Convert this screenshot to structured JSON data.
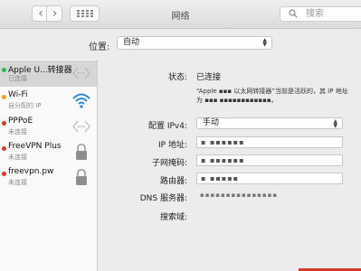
{
  "window": {
    "title": "网络"
  },
  "toolbar": {
    "back_glyph": "‹",
    "forward_glyph": "›"
  },
  "search": {
    "placeholder": "搜索"
  },
  "location": {
    "label": "位置:",
    "value": "自动"
  },
  "services": [
    {
      "name": "Apple U...转接器",
      "status": "已连接",
      "status_color": "#2fbd4a",
      "icon": "ethernet-arrows-icon"
    },
    {
      "name": "Wi-Fi",
      "status": "自分配的 IP",
      "status_color": "#f0a020",
      "icon": "wifi-icon"
    },
    {
      "name": "PPPoE",
      "status": "未连接",
      "status_color": "#d9382a",
      "icon": "ethernet-arrows-icon"
    },
    {
      "name": "FreeVPN Plus",
      "status": "未连接",
      "status_color": "#d9382a",
      "icon": "lock-icon"
    },
    {
      "name": "freevpn.pw",
      "status": "未连接",
      "status_color": "#d9382a",
      "icon": "lock-icon"
    }
  ],
  "detail": {
    "status_label": "状态:",
    "status_value": "已连接",
    "description": "“Apple ▪▪▪ 以太网转接器”当前是活跃的，其 IP 地址为 ▪▪▪ ▪▪▪▪▪▪▪▪▪▪▪▪。",
    "configure_label": "配置 IPv4:",
    "configure_value": "手动",
    "ip_label": "IP 地址:",
    "ip_value": "▪ ▪▪▪▪▪▪",
    "subnet_label": "子网掩码:",
    "subnet_value": "▪ ▪▪▪▪▪▪",
    "router_label": "路由器:",
    "router_value": "▪ ▪▪▪▪▪",
    "dns_label": "DNS 服务器:",
    "dns_value": "▪▪▪▪▪▪▪▪▪▪▪▪▪▪▪",
    "search_domain_label": "搜索域:"
  },
  "colors": {
    "active_row": "#d6d6d6",
    "accent_red": "#d43d2a"
  }
}
